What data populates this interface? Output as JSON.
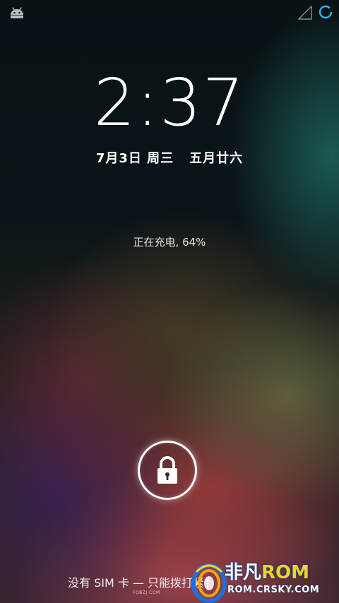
{
  "status_bar": {
    "left_icon": "android-debug-icon",
    "right_icons": [
      "signal-empty-icon",
      "sync-icon"
    ]
  },
  "lockscreen": {
    "time": "2:37",
    "date": "7月3日 周三",
    "lunar_date": "五月廿六",
    "charging_status": "正在充电, 64%",
    "unlock_icon": "lock-icon",
    "carrier_text": "没有 SIM 卡 — 只能拨打紧急呼叫"
  },
  "watermarks": {
    "small_text": "FOBZJ.COM",
    "logo_brand": "非凡",
    "logo_rom": "ROM",
    "logo_url": "ROM.CRSKY.COM"
  },
  "colors": {
    "text": "#ffffff",
    "sync_accent": "#33b5e5",
    "logo_yellow": "#f7d21a",
    "logo_blue": "#0a3d8c"
  }
}
